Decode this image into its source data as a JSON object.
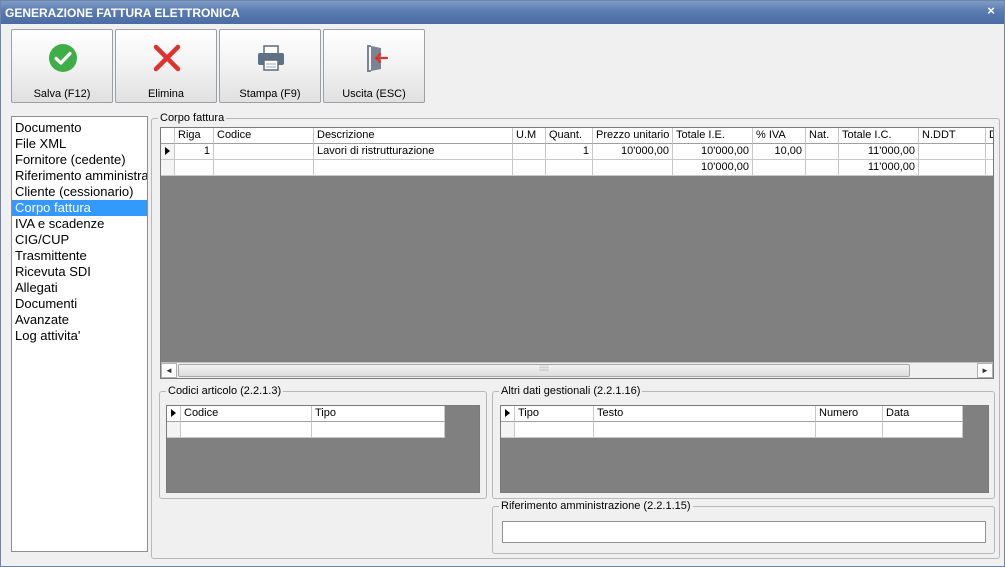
{
  "window": {
    "title": "GENERAZIONE FATTURA ELETTRONICA",
    "close_glyph": "×"
  },
  "toolbar": {
    "save_label": "Salva (F12)",
    "delete_label": "Elimina",
    "print_label": "Stampa (F9)",
    "exit_label": "Uscita (ESC)"
  },
  "nav": {
    "items": [
      "Documento",
      "File XML",
      "Fornitore (cedente)",
      "Riferimento amministrazione",
      "Cliente (cessionario)",
      "Corpo fattura",
      "IVA e scadenze",
      "CIG/CUP",
      "Trasmittente",
      "Ricevuta SDI",
      "Allegati",
      "Documenti",
      "Avanzate",
      "Log attivita'"
    ],
    "selected": "Corpo fattura"
  },
  "corpo": {
    "group_label": "Corpo fattura",
    "columns": [
      "Riga",
      "Codice",
      "Descrizione",
      "U.M",
      "Quant.",
      "Prezzo unitario",
      "Totale I.E.",
      "% IVA",
      "Nat.",
      "Totale I.C.",
      "N.DDT",
      "D"
    ],
    "rows": [
      [
        "1",
        "",
        "Lavori di ristrutturazione",
        "",
        "1",
        "10'000,00",
        "10'000,00",
        "10,00",
        "",
        "11'000,00",
        "",
        ""
      ]
    ],
    "totals": [
      "",
      "",
      "",
      "",
      "",
      "",
      "10'000,00",
      "",
      "",
      "11'000,00",
      "",
      ""
    ],
    "scroll_left": "◄",
    "scroll_right": "►",
    "grip": "⁞⁞⁞⁞⁞"
  },
  "codici": {
    "group_label": "Codici articolo (2.2.1.3)",
    "columns": [
      "Codice",
      "Tipo"
    ]
  },
  "altri": {
    "group_label": "Altri dati gestionali (2.2.1.16)",
    "columns": [
      "Tipo",
      "Testo",
      "Numero",
      "Data"
    ]
  },
  "rifamm": {
    "group_label": "Riferimento amministrazione (2.2.1.15)",
    "value": ""
  },
  "colors": {
    "title_bar": "#5a7bb0",
    "selection": "#3399ff",
    "grid_bg": "#808080",
    "save_green": "#3fae49",
    "delete_red": "#e0322c"
  }
}
